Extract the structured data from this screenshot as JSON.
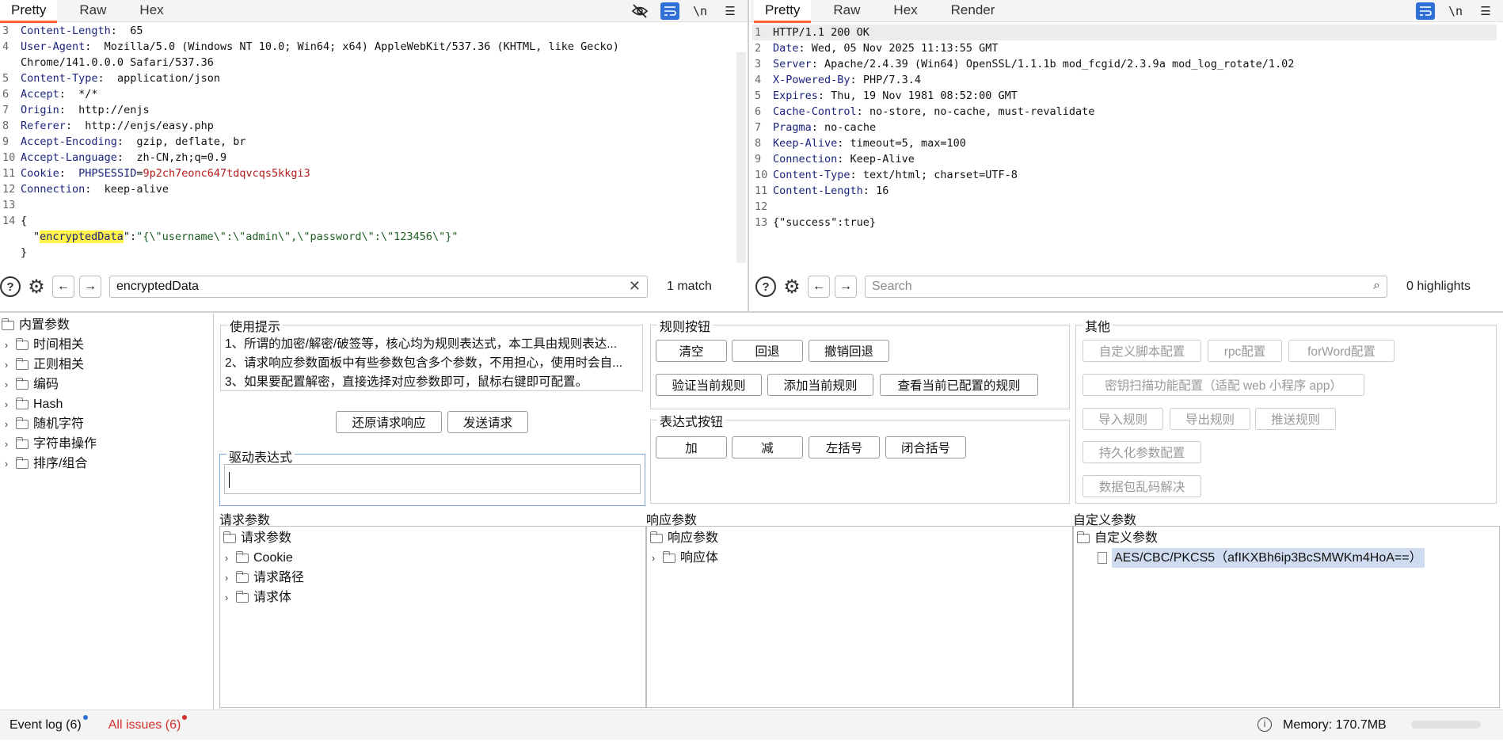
{
  "request": {
    "tabs": [
      "Pretty",
      "Raw",
      "Hex"
    ],
    "icons": [
      "eye-slash-icon",
      "wrap-icon",
      "newline-icon",
      "menu-icon"
    ],
    "newline_label": "\\n",
    "lines": [
      {
        "n": "3",
        "k": "Content-Length",
        "v": " 65"
      },
      {
        "n": "4",
        "k": "User-Agent",
        "v": " Mozilla/5.0 (Windows NT 10.0; Win64; x64) AppleWebKit/537.36 (KHTML, like Gecko)"
      },
      {
        "n": "",
        "k": "",
        "v": "Chrome/141.0.0.0 Safari/537.36"
      },
      {
        "n": "5",
        "k": "Content-Type",
        "v": " application/json"
      },
      {
        "n": "6",
        "k": "Accept",
        "v": " */*"
      },
      {
        "n": "7",
        "k": "Origin",
        "v": " http://enjs"
      },
      {
        "n": "8",
        "k": "Referer",
        "v": " http://enjs/easy.php"
      },
      {
        "n": "9",
        "k": "Accept-Encoding",
        "v": " gzip, deflate, br"
      },
      {
        "n": "10",
        "k": "Accept-Language",
        "v": " zh-CN,zh;q=0.9"
      },
      {
        "n": "11",
        "k": "Cookie",
        "v": " PHPSESSID=9p2ch7eonc647tdqvcqs5kkgi3"
      },
      {
        "n": "12",
        "k": "Connection",
        "v": " keep-alive"
      },
      {
        "n": "13",
        "k": "",
        "v": ""
      },
      {
        "n": "14",
        "k": "",
        "v": "{"
      },
      {
        "n": "",
        "k": "",
        "v": ""
      },
      {
        "n": "",
        "k": "",
        "v": "}"
      }
    ],
    "cookie_name": "PHPSESSID",
    "cookie_value": "9p2ch7eonc647tdqvcqs5kkgi3",
    "json_key": "encryptedData",
    "json_value": "\"{\\\"username\\\":\\\"admin\\\",\\\"password\\\":\\\"123456\\\"}\"",
    "search_value": "encryptedData",
    "match_text": "1 match"
  },
  "response": {
    "tabs": [
      "Pretty",
      "Raw",
      "Hex",
      "Render"
    ],
    "newline_label": "\\n",
    "lines": [
      {
        "n": "1",
        "k": "",
        "v": "HTTP/1.1 200 OK"
      },
      {
        "n": "2",
        "k": "Date",
        "v": " Wed, 05 Nov 2025 11:13:55 GMT"
      },
      {
        "n": "3",
        "k": "Server",
        "v": " Apache/2.4.39 (Win64) OpenSSL/1.1.1b mod_fcgid/2.3.9a mod_log_rotate/1.02"
      },
      {
        "n": "4",
        "k": "X-Powered-By",
        "v": " PHP/7.3.4"
      },
      {
        "n": "5",
        "k": "Expires",
        "v": " Thu, 19 Nov 1981 08:52:00 GMT"
      },
      {
        "n": "6",
        "k": "Cache-Control",
        "v": " no-store, no-cache, must-revalidate"
      },
      {
        "n": "7",
        "k": "Pragma",
        "v": " no-cache"
      },
      {
        "n": "8",
        "k": "Keep-Alive",
        "v": " timeout=5, max=100"
      },
      {
        "n": "9",
        "k": "Connection",
        "v": " Keep-Alive"
      },
      {
        "n": "10",
        "k": "Content-Type",
        "v": " text/html; charset=UTF-8"
      },
      {
        "n": "11",
        "k": "Content-Length",
        "v": " 16"
      },
      {
        "n": "12",
        "k": "",
        "v": ""
      },
      {
        "n": "13",
        "k": "",
        "v": "{\"success\":true}"
      }
    ],
    "search_placeholder": "Search",
    "highlights_text": "0 highlights"
  },
  "builtin_tree": {
    "root": "内置参数",
    "items": [
      "时间相关",
      "正则相关",
      "编码",
      "Hash",
      "随机字符",
      "字符串操作",
      "排序/组合"
    ]
  },
  "tips": {
    "title": "使用提示",
    "lines": [
      "1、所谓的加密/解密/破签等，核心均为规则表达式，本工具由规则表达...",
      "2、请求响应参数面板中有些参数包含多个参数，不用担心，使用时会自...",
      "3、如果要配置解密，直接选择对应参数即可，鼠标右键即可配置。"
    ]
  },
  "actions": {
    "restore": "还原请求响应",
    "send": "发送请求"
  },
  "driver": {
    "title": "驱动表达式",
    "value": ""
  },
  "rule_buttons": {
    "title": "规则按钮",
    "clear": "清空",
    "undo": "回退",
    "redo": "撤销回退",
    "verify": "验证当前规则",
    "add": "添加当前规则",
    "view": "查看当前已配置的规则"
  },
  "expr_buttons": {
    "title": "表达式按钮",
    "add": "加",
    "sub": "减",
    "lparen": "左括号",
    "rparen": "闭合括号"
  },
  "other": {
    "title": "其他",
    "custom_script": "自定义脚本配置",
    "rpc": "rpc配置",
    "forword": "forWord配置",
    "key_scan": "密钥扫描功能配置（适配 web 小程序 app）",
    "import": "导入规则",
    "export": "导出规则",
    "push": "推送规则",
    "persist": "持久化参数配置",
    "garbled": "数据包乱码解决"
  },
  "request_params": {
    "title": "请求参数",
    "root": "请求参数",
    "items": [
      "Cookie",
      "请求路径",
      "请求体"
    ]
  },
  "response_params": {
    "title": "响应参数",
    "root": "响应参数",
    "items": [
      "响应体"
    ]
  },
  "custom_params": {
    "title": "自定义参数",
    "root": "自定义参数",
    "item": "AES/CBC/PKCS5（afIKXBh6ip3BcSMWKm4HoA==）"
  },
  "status": {
    "event_log": "Event log (6)",
    "issues": "All issues (6)",
    "memory": "Memory: 170.7MB",
    "colors": {
      "event_dot": "#2f6fd6",
      "issues": "#d32f2f",
      "issues_dot": "#d32f2f"
    }
  }
}
